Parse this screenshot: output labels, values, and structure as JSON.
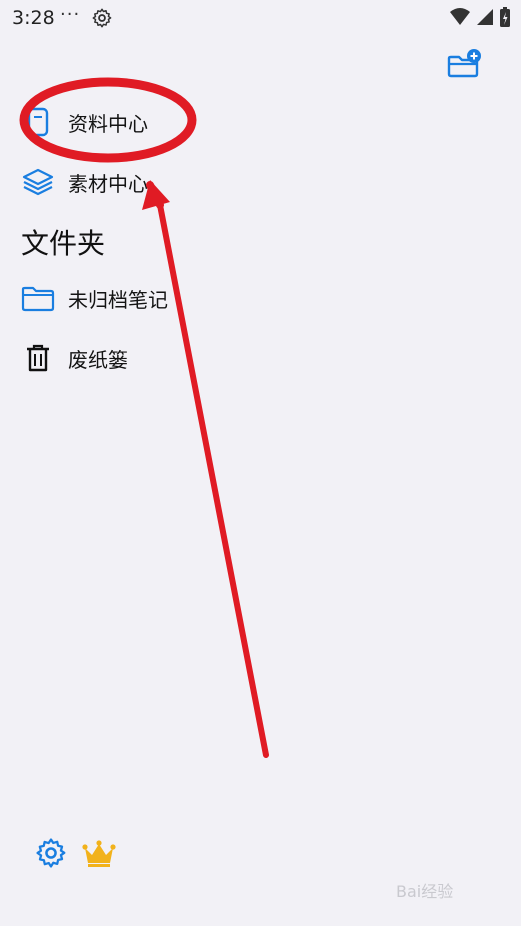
{
  "status_bar": {
    "time": "3:28",
    "dots": "···"
  },
  "nav": {
    "items": [
      {
        "label": "资料中心",
        "icon": "document-icon"
      },
      {
        "label": "素材中心",
        "icon": "layers-icon"
      }
    ]
  },
  "folders": {
    "title": "文件夹",
    "items": [
      {
        "label": "未归档笔记",
        "icon": "folder-icon"
      },
      {
        "label": "废纸篓",
        "icon": "trash-icon"
      }
    ]
  },
  "bottom": {
    "settings_icon": "gear-icon",
    "vip_icon": "crown-icon"
  },
  "colors": {
    "accent": "#1a7ee0",
    "crown": "#f2b21b",
    "annotation": "#e01b24",
    "background": "#f2f1f6"
  },
  "watermark": "Bai经验"
}
